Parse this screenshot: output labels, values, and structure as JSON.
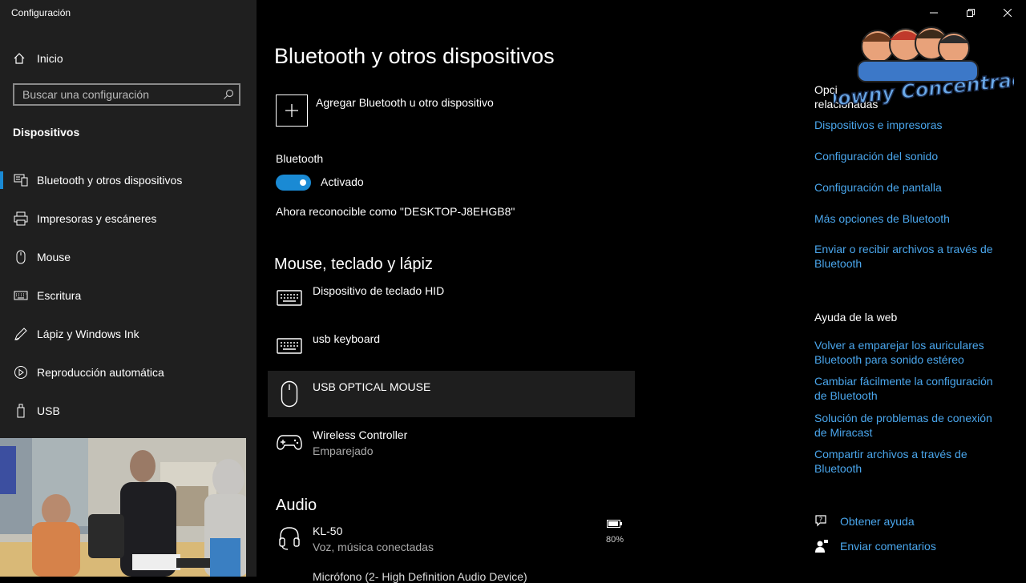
{
  "app": {
    "title": "Configuración"
  },
  "sidebar": {
    "home_label": "Inicio",
    "search_placeholder": "Buscar una configuración",
    "section": "Dispositivos",
    "items": [
      {
        "label": "Bluetooth y otros dispositivos",
        "icon": "bluetooth-devices-icon",
        "active": true
      },
      {
        "label": "Impresoras y escáneres",
        "icon": "printer-icon"
      },
      {
        "label": "Mouse",
        "icon": "mouse-icon"
      },
      {
        "label": "Escritura",
        "icon": "keyboard-icon"
      },
      {
        "label": "Lápiz y Windows Ink",
        "icon": "pen-icon"
      },
      {
        "label": "Reproducción automática",
        "icon": "autoplay-icon"
      },
      {
        "label": "USB",
        "icon": "usb-icon"
      }
    ]
  },
  "main": {
    "title": "Bluetooth y otros dispositivos",
    "add_device_label": "Agregar Bluetooth u otro dispositivo",
    "bluetooth_label": "Bluetooth",
    "toggle_state": "Activado",
    "discoverable": "Ahora reconocible como \"DESKTOP-J8EHGB8\"",
    "section_input": "Mouse, teclado y lápiz",
    "devices": [
      {
        "name": "Dispositivo de teclado HID",
        "icon": "keyboard-icon"
      },
      {
        "name": "usb keyboard",
        "icon": "keyboard-icon"
      },
      {
        "name": "USB OPTICAL MOUSE",
        "icon": "mouse-icon",
        "selected": true
      },
      {
        "name": "Wireless Controller",
        "status": "Emparejado",
        "icon": "gamepad-icon"
      }
    ],
    "section_audio": "Audio",
    "audio_devices": [
      {
        "name": "KL-50",
        "status": "Voz, música conectadas",
        "battery": "80%",
        "icon": "headset-icon"
      }
    ],
    "cutoff_text": "Micrófono (2- High Definition Audio Device)"
  },
  "related": {
    "heading_partial": "Opci",
    "heading_line2": "relacionadas",
    "links": [
      "Dispositivos e impresoras",
      "Configuración del sonido",
      "Configuración de pantalla",
      "Más opciones de Bluetooth",
      "Enviar o recibir archivos a través de Bluetooth"
    ]
  },
  "web_help": {
    "heading": "Ayuda de la web",
    "links": [
      "Volver a emparejar los auriculares Bluetooth para sonido estéreo",
      "Cambiar fácilmente la configuración de Bluetooth",
      "Solución de problemas de conexión de Miracast",
      "Compartir archivos a través de Bluetooth"
    ]
  },
  "help": {
    "get_help": "Obtener ayuda",
    "feedback": "Enviar comentarios"
  },
  "watermark": {
    "text": "Downy Concentrao"
  },
  "colors": {
    "accent": "#1a8ad4",
    "link": "#4aa6ec",
    "sidebar_bg": "#1f1f1f",
    "main_bg": "#000000"
  }
}
